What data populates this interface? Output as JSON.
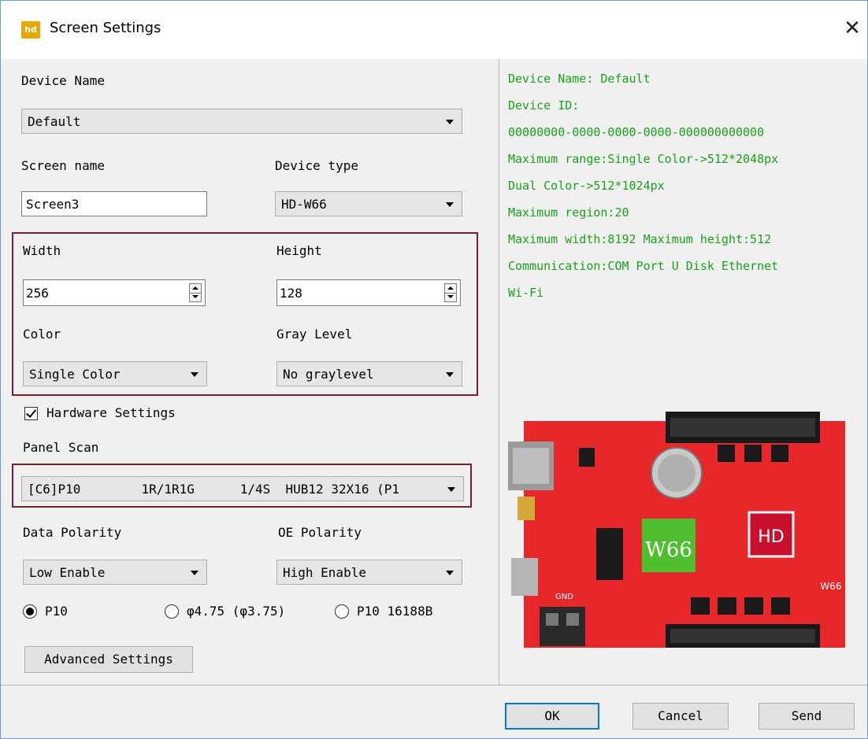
{
  "window": {
    "title": "Screen Settings",
    "icon": "app-logo-icon",
    "icon_text": "hd"
  },
  "form": {
    "device_name_label": "Device Name",
    "device_name_value": "Default",
    "screen_name_label": "Screen name",
    "screen_name_value": "Screen3",
    "device_type_label": "Device type",
    "device_type_value": "HD-W66",
    "width_label": "Width",
    "width_value": "256",
    "height_label": "Height",
    "height_value": "128",
    "color_label": "Color",
    "color_value": "Single Color",
    "gray_label": "Gray Level",
    "gray_value": "No graylevel",
    "hardware_label": "Hardware Settings",
    "hardware_checked": true,
    "panel_scan_label": "Panel Scan",
    "panel_scan_value": "[C6]P10        1R/1R1G      1/4S  HUB12 32X16 (P1",
    "data_polarity_label": "Data Polarity",
    "data_polarity_value": "Low Enable",
    "oe_polarity_label": "OE Polarity",
    "oe_polarity_value": "High Enable",
    "radio_options": [
      "P10",
      "φ4.75 (φ3.75)",
      "P10 16188B"
    ],
    "radio_selected": "P10",
    "advanced_button": "Advanced Settings"
  },
  "info": {
    "lines": [
      "Device Name: Default",
      "Device ID:",
      "00000000-0000-0000-0000-000000000000",
      "Maximum range:Single Color->512*2048px",
      "Dual Color->512*1024px",
      "Maximum region:20",
      "Maximum width:8192 Maximum height:512",
      "Communication:COM Port  U Disk  Ethernet",
      "Wi-Fi"
    ],
    "color": "#1aa11a"
  },
  "board": {
    "chip_label": "W66",
    "chip_sub": "66",
    "hd_label": "HD",
    "corner_label": "W66",
    "gnd_label": "GND"
  },
  "buttons": {
    "ok": "OK",
    "cancel": "Cancel",
    "send": "Send"
  },
  "colors": {
    "highlight_box": "#7a1e2e",
    "board_red": "#e8272a",
    "chip_green": "#4fbf2f"
  }
}
